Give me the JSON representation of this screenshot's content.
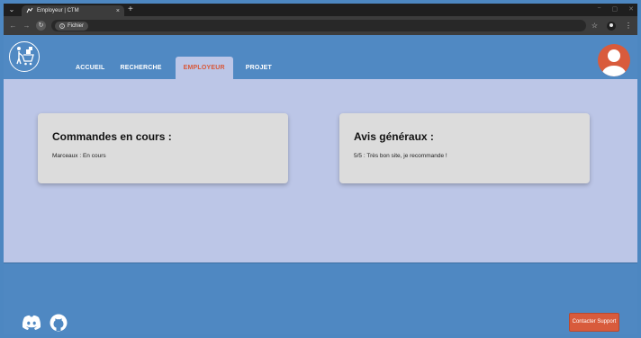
{
  "browser": {
    "tab_title": "Employeur | CTM",
    "tab_close": "×",
    "new_tab": "+",
    "site_chip_label": "Fichier",
    "win_minimize": "−",
    "win_maximize": "▢",
    "win_close": "✕",
    "star_icon": "star-icon",
    "menu_icon": "kebab-menu-icon"
  },
  "header": {
    "nav": [
      "ACCUEIL",
      "RECHERCHE",
      "EMPLOYEUR",
      "PROJET"
    ],
    "active_index": 2
  },
  "cards": [
    {
      "title": "Commandes en cours :",
      "text": "Marceaux : En cours"
    },
    {
      "title": "Avis généraux :",
      "text": "5/5 : Très bon site, je recommande !"
    }
  ],
  "footer": {
    "support_label": "Contacter Support",
    "icons": [
      "discord-icon",
      "github-icon"
    ]
  },
  "colors": {
    "header": "#5089c3",
    "main_bg": "#bcc6e7",
    "accent": "#d95b3c"
  }
}
